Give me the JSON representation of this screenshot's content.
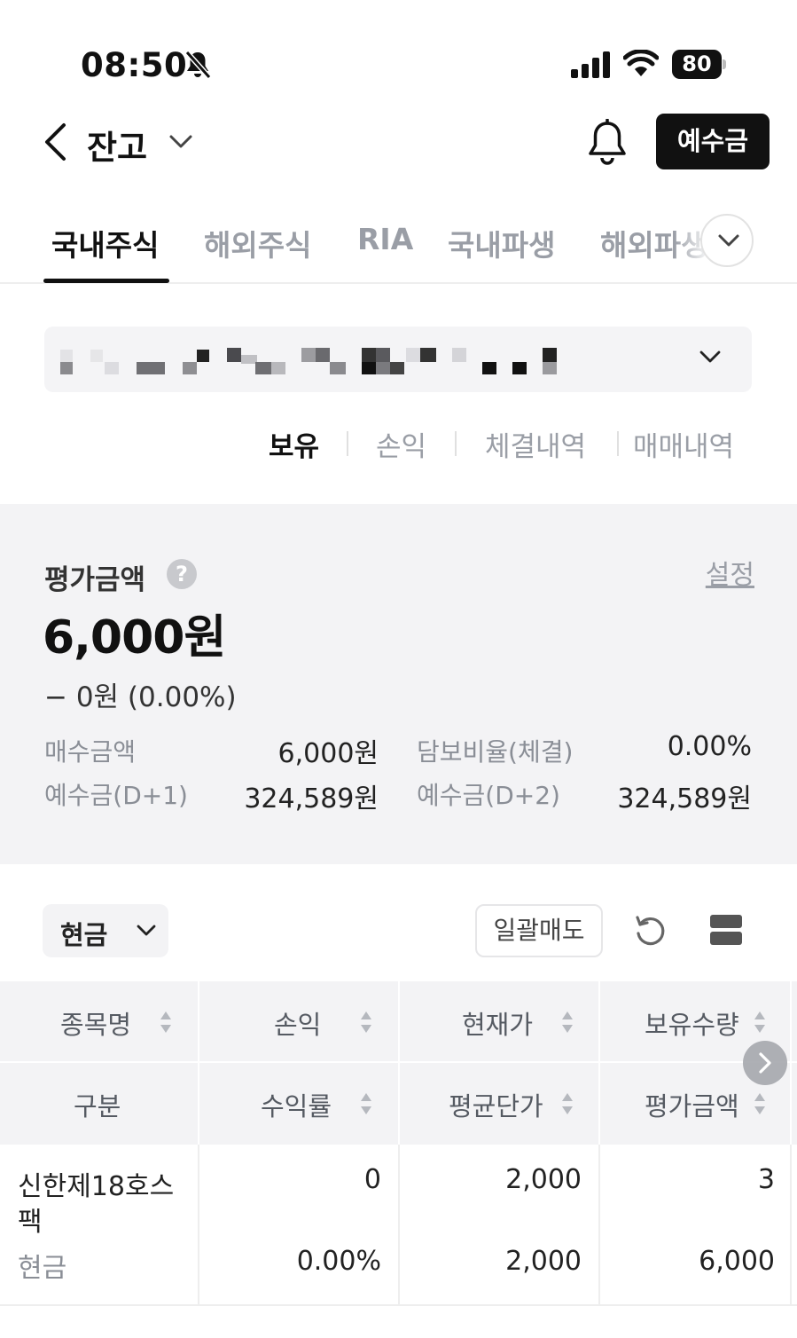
{
  "status_bar": {
    "time": "08:50",
    "battery": "80",
    "icons": [
      "bell-slash-icon",
      "signal-icon",
      "wifi-icon",
      "battery-icon"
    ]
  },
  "header": {
    "title": "잔고",
    "deposit_button": "예수금"
  },
  "tabs": [
    {
      "label": "국내주식",
      "active": true
    },
    {
      "label": "해외주식",
      "active": false
    },
    {
      "label": "RIA",
      "active": false
    },
    {
      "label": "국내파생",
      "active": false
    },
    {
      "label": "해외파생",
      "active": false
    }
  ],
  "subtabs": [
    {
      "label": "보유",
      "active": true
    },
    {
      "label": "손익",
      "active": false
    },
    {
      "label": "체결내역",
      "active": false
    },
    {
      "label": "매매내역",
      "active": false
    }
  ],
  "summary": {
    "eval_label": "평가금액",
    "help": "?",
    "settings": "설정",
    "eval_amount": "6,000원",
    "eval_change": "− 0원 (0.00%)",
    "purchase_label": "매수금액",
    "purchase_value": "6,000원",
    "collateral_label": "담보비율(체결)",
    "collateral_value": "0.00%",
    "deposit_d1_label": "예수금(D+1)",
    "deposit_d1_value": "324,589원",
    "deposit_d2_label": "예수금(D+2)",
    "deposit_d2_value": "324,589원"
  },
  "toolbar": {
    "cash_select": "현금",
    "bulk_sell": "일괄매도"
  },
  "table": {
    "header_row1": [
      "종목명",
      "손익",
      "현재가",
      "보유수량"
    ],
    "header_row2": [
      "구분",
      "수익률",
      "평균단가",
      "평가금액"
    ],
    "rows": [
      {
        "name_line1": "신한제18호스",
        "name_line2": "팩",
        "type": "현금",
        "profit": "0",
        "return_rate": "0.00%",
        "current_price": "2,000",
        "avg_price": "2,000",
        "quantity": "3",
        "eval_amount": "6,000"
      }
    ]
  },
  "colors": {
    "accent_dark": "#111111",
    "muted_text": "#9a9ea6",
    "panel_bg": "#f3f3f5"
  }
}
